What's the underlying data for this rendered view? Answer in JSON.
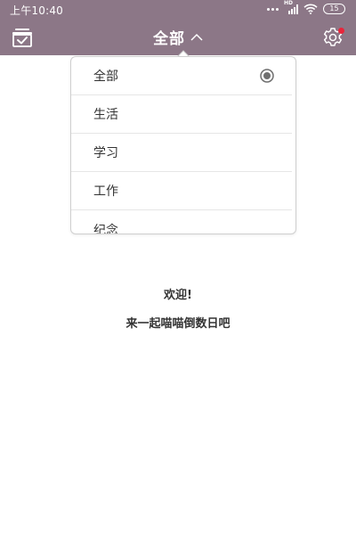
{
  "status_bar": {
    "time": "上午10:40",
    "network_label": "HD",
    "battery_level": "15"
  },
  "app_bar": {
    "title": "全部",
    "calendar_icon": "calendar-check-icon",
    "settings_icon": "gear-icon",
    "title_chevron_icon": "chevron-up-icon"
  },
  "dropdown": {
    "items": [
      {
        "label": "全部",
        "selected": true
      },
      {
        "label": "生活"
      },
      {
        "label": "学习"
      },
      {
        "label": "工作"
      },
      {
        "label": "纪念"
      }
    ]
  },
  "empty_state": {
    "line1": "欢迎!",
    "line2": "来一起喵喵倒数日吧"
  },
  "colors": {
    "header": "#8c7787",
    "accent_dot": "#e8253b",
    "text": "#333333"
  }
}
